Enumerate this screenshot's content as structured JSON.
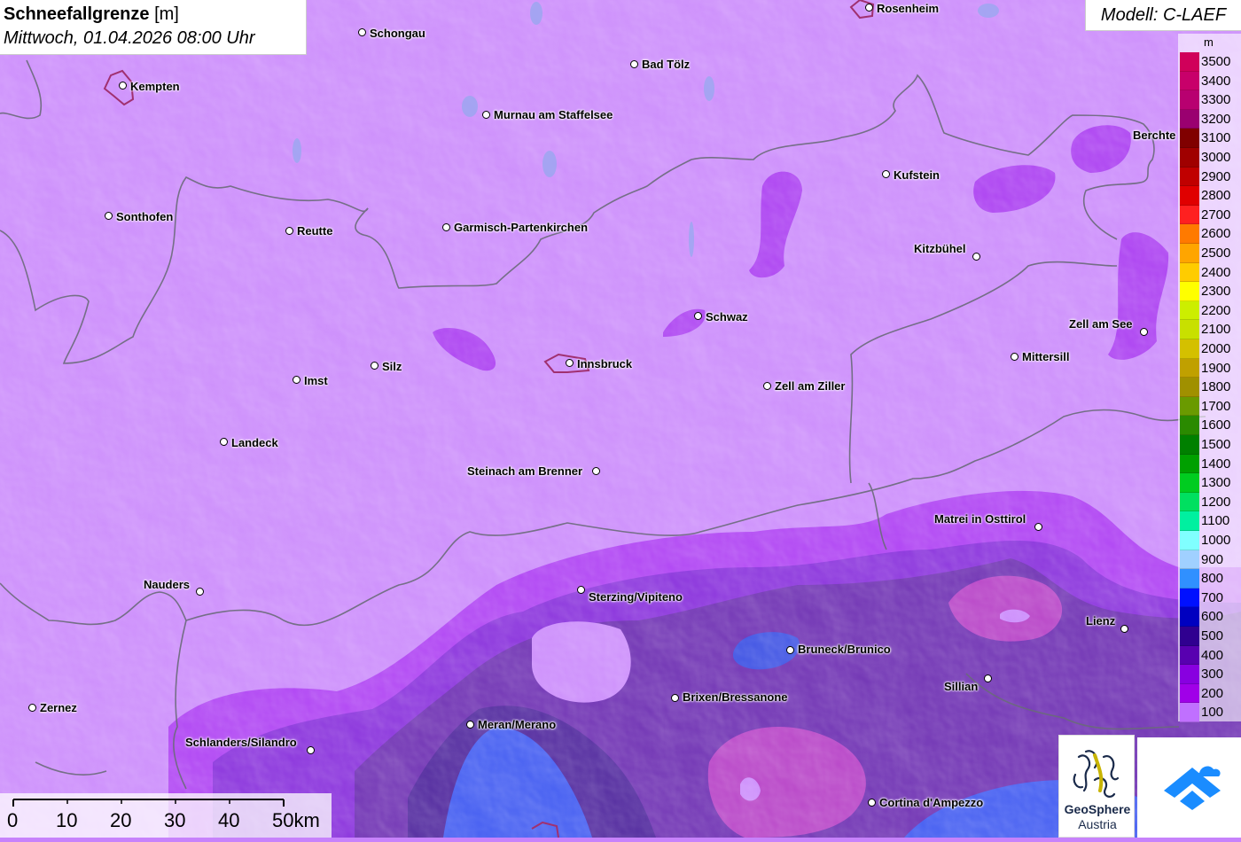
{
  "title": {
    "main_bold": "Schneefallgrenze",
    "main_unit": "[m]",
    "date": "Mittwoch, 01.04.2026 08:00 Uhr"
  },
  "model": "Modell: C-LAEF",
  "legend": {
    "unit": "m",
    "items": [
      {
        "label": "3500",
        "color": "#d0005a"
      },
      {
        "label": "3400",
        "color": "#c8006a"
      },
      {
        "label": "3300",
        "color": "#b80070"
      },
      {
        "label": "3200",
        "color": "#9a0070"
      },
      {
        "label": "3100",
        "color": "#800000"
      },
      {
        "label": "3000",
        "color": "#a00000"
      },
      {
        "label": "2900",
        "color": "#c00000"
      },
      {
        "label": "2800",
        "color": "#e00000"
      },
      {
        "label": "2700",
        "color": "#ff2020"
      },
      {
        "label": "2600",
        "color": "#ff7a00"
      },
      {
        "label": "2500",
        "color": "#ffa500"
      },
      {
        "label": "2400",
        "color": "#ffcc00"
      },
      {
        "label": "2300",
        "color": "#ffff00"
      },
      {
        "label": "2200",
        "color": "#ccee00"
      },
      {
        "label": "2100",
        "color": "#c8e000"
      },
      {
        "label": "2000",
        "color": "#d4c000"
      },
      {
        "label": "1900",
        "color": "#c0a000"
      },
      {
        "label": "1800",
        "color": "#a09000"
      },
      {
        "label": "1700",
        "color": "#6a9a00"
      },
      {
        "label": "1600",
        "color": "#2a8a00"
      },
      {
        "label": "1500",
        "color": "#008000"
      },
      {
        "label": "1400",
        "color": "#00a000"
      },
      {
        "label": "1300",
        "color": "#00cc20"
      },
      {
        "label": "1200",
        "color": "#00e060"
      },
      {
        "label": "1100",
        "color": "#00f0a0"
      },
      {
        "label": "1000",
        "color": "#80ffff"
      },
      {
        "label": "900",
        "color": "#a0d0ff"
      },
      {
        "label": "800",
        "color": "#3090ff"
      },
      {
        "label": "700",
        "color": "#0010ff"
      },
      {
        "label": "600",
        "color": "#0000c0"
      },
      {
        "label": "500",
        "color": "#300090"
      },
      {
        "label": "400",
        "color": "#5800b0"
      },
      {
        "label": "300",
        "color": "#8800e0"
      },
      {
        "label": "200",
        "color": "#a000e8"
      },
      {
        "label": "100",
        "color": "#c070ff"
      }
    ]
  },
  "cities": [
    {
      "name": "Rosenheim"
    },
    {
      "name": "Schongau"
    },
    {
      "name": "Bad Tölz"
    },
    {
      "name": "Kempten"
    },
    {
      "name": "Murnau am Staffelsee"
    },
    {
      "name": "Berchte"
    },
    {
      "name": "Kufstein"
    },
    {
      "name": "Sonthofen"
    },
    {
      "name": "Reutte"
    },
    {
      "name": "Garmisch-Partenkirchen"
    },
    {
      "name": "Kitzbühel"
    },
    {
      "name": "Schwaz"
    },
    {
      "name": "Zell am See"
    },
    {
      "name": "Mittersill"
    },
    {
      "name": "Silz"
    },
    {
      "name": "Innsbruck"
    },
    {
      "name": "Imst"
    },
    {
      "name": "Zell am Ziller"
    },
    {
      "name": "Landeck"
    },
    {
      "name": "Steinach am Brenner"
    },
    {
      "name": "Matrei in Osttirol"
    },
    {
      "name": "Nauders"
    },
    {
      "name": "Sterzing/Vipiteno"
    },
    {
      "name": "Lienz"
    },
    {
      "name": "Bruneck/Brunico"
    },
    {
      "name": "Sillian"
    },
    {
      "name": "Brixen/Bressanone"
    },
    {
      "name": "Zernez"
    },
    {
      "name": "Meran/Merano"
    },
    {
      "name": "Schlanders/Silandro"
    },
    {
      "name": "Cortina d'Ampezzo"
    }
  ],
  "scale": {
    "labels": [
      "0",
      "10",
      "20",
      "30",
      "40",
      "50km"
    ]
  },
  "logos": {
    "geosphere_line1": "GeoSphere",
    "geosphere_line2": "Austria",
    "app_icon": "cloud-arrow-icon"
  }
}
